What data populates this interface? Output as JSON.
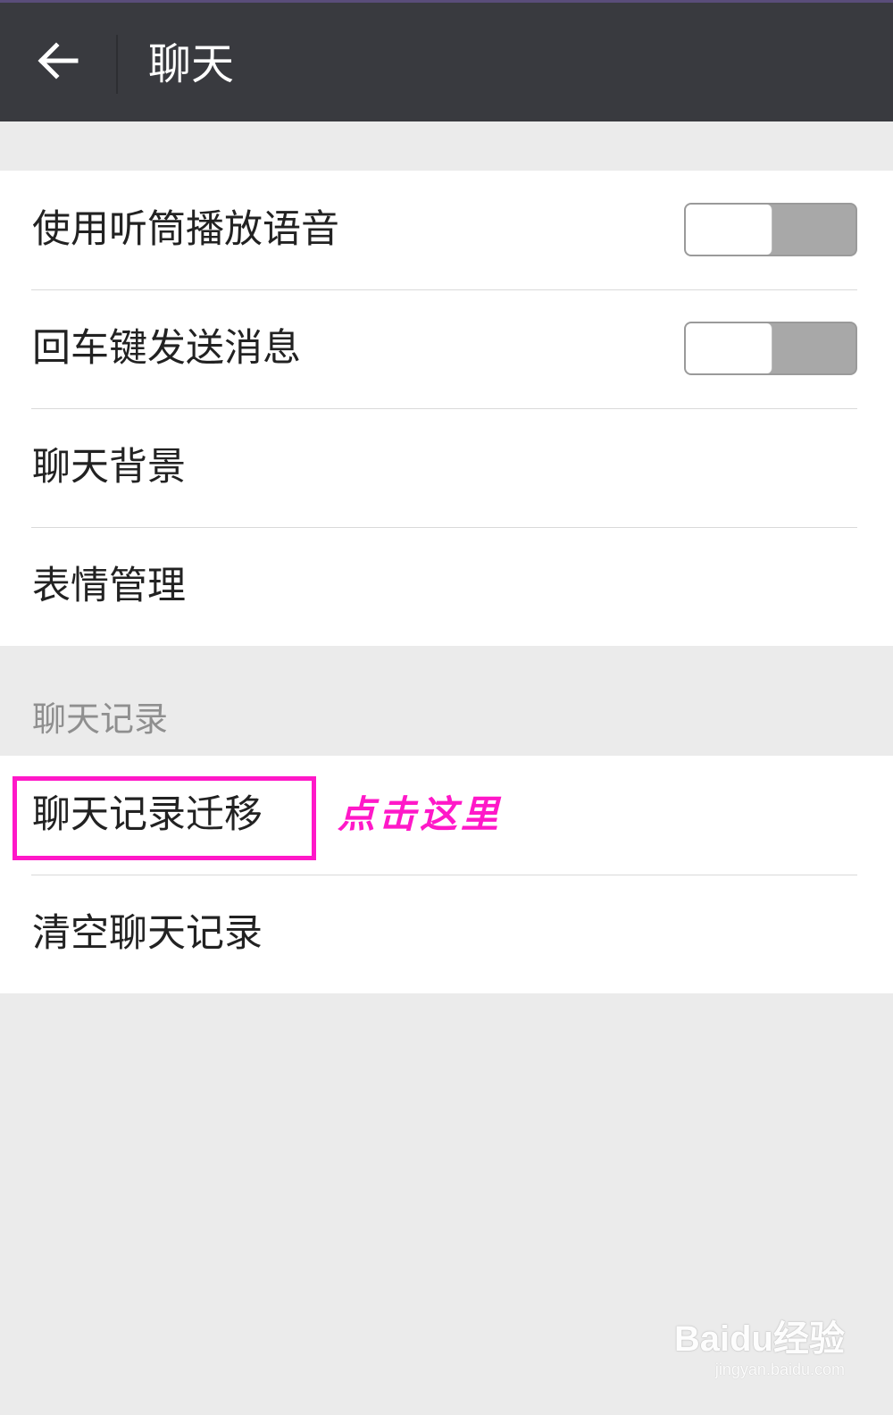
{
  "header": {
    "title": "聊天"
  },
  "settings_group": {
    "items": [
      {
        "label": "使用听筒播放语音",
        "toggle": "off"
      },
      {
        "label": "回车键发送消息",
        "toggle": "off"
      },
      {
        "label": "聊天背景"
      },
      {
        "label": "表情管理"
      }
    ]
  },
  "history_section": {
    "header": "聊天记录",
    "items": [
      {
        "label": "聊天记录迁移"
      },
      {
        "label": "清空聊天记录"
      }
    ]
  },
  "annotation": {
    "text": "点击这里",
    "color": "#ff18c8"
  },
  "watermark": {
    "logo": "Baidu经验",
    "url": "jingyan.baidu.com"
  },
  "colors": {
    "topbar": "#393a3f",
    "background": "#ebebeb",
    "highlight": "#ff18c8"
  },
  "icons": {
    "back": "arrow-left-icon"
  }
}
